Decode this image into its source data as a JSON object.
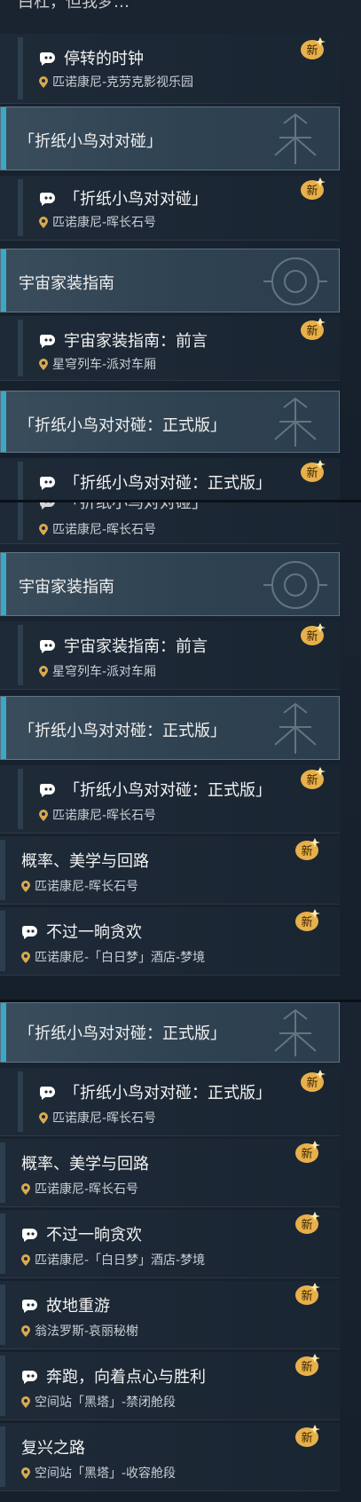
{
  "segment1": {
    "cut_top_text": "白杠，但我梦...(截断)",
    "items": [
      {
        "type": "item",
        "name": "停转的时钟",
        "loc": "匹诺康尼-克劳克影视乐园",
        "icon": true
      },
      {
        "type": "header",
        "title": "「折纸小鸟对对碰」"
      },
      {
        "type": "item",
        "name": "「折纸小鸟对对碰」",
        "loc": "匹诺康尼-晖长石号",
        "icon": true
      },
      {
        "type": "header",
        "title": "宇宙家装指南"
      },
      {
        "type": "item",
        "name": "宇宙家装指南：前言",
        "loc": "星穹列车-派对车厢",
        "icon": true
      },
      {
        "type": "header",
        "title": "「折纸小鸟对对碰：正式版」"
      },
      {
        "type": "item",
        "name": "「折纸小鸟对对碰：正式版」",
        "loc": "",
        "icon": true
      }
    ]
  },
  "segment2": {
    "items": [
      {
        "type": "item",
        "name": "「折纸小鸟对对碰」",
        "loc": "匹诺康尼-晖长石号",
        "icon": true
      },
      {
        "type": "header",
        "title": "宇宙家装指南"
      },
      {
        "type": "item",
        "name": "宇宙家装指南：前言",
        "loc": "星穹列车-派对车厢",
        "icon": true
      },
      {
        "type": "header",
        "title": "「折纸小鸟对对碰：正式版」"
      },
      {
        "type": "item",
        "name": "「折纸小鸟对对碰：正式版」",
        "loc": "匹诺康尼-晖长石号",
        "icon": true
      },
      {
        "type": "item",
        "name": "概率、美学与回路",
        "loc": "匹诺康尼-晖长石号",
        "icon": false
      },
      {
        "type": "item",
        "name": "不过一晌贪欢",
        "loc": "匹诺康尼-「白日梦」酒店-梦境",
        "icon": true
      }
    ]
  },
  "segment3": {
    "items": [
      {
        "type": "header",
        "title": "「折纸小鸟对对碰：正式版」"
      },
      {
        "type": "item",
        "name": "「折纸小鸟对对碰：正式版」",
        "loc": "匹诺康尼-晖长石号",
        "icon": true
      },
      {
        "type": "item",
        "name": "概率、美学与回路",
        "loc": "匹诺康尼-晖长石号",
        "icon": false
      },
      {
        "type": "item",
        "name": "不过一晌贪欢",
        "loc": "匹诺康尼-「白日梦」酒店-梦境",
        "icon": true
      },
      {
        "type": "item",
        "name": "故地重游",
        "loc": "翁法罗斯-哀丽秘榭",
        "icon": true
      },
      {
        "type": "item",
        "name": "奔跑，向着点心与胜利",
        "loc": "空间站「黑塔」-禁闭舱段",
        "icon": true
      },
      {
        "type": "item",
        "name": "复兴之路",
        "loc": "空间站「黑塔」-收容舱段",
        "icon": false
      }
    ]
  },
  "badge_label": "新",
  "colors": {
    "accent": "#3ba8c6",
    "badge": "#e8b04a",
    "pin": "#d9a94e"
  }
}
